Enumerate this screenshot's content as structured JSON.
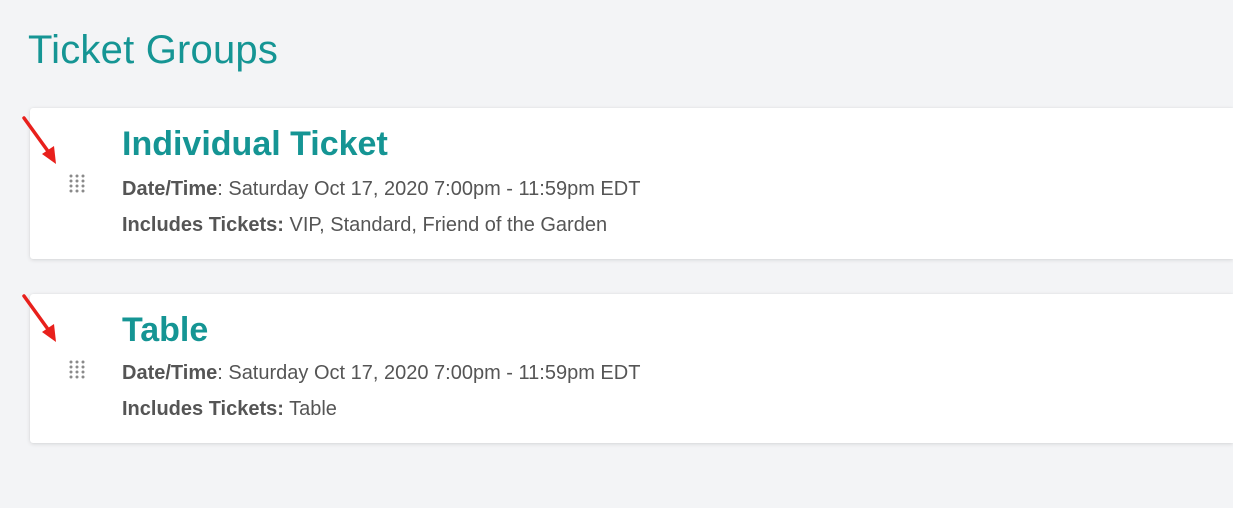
{
  "page": {
    "title": "Ticket Groups"
  },
  "groups": [
    {
      "name": "Individual Ticket",
      "date_label": "Date/Time",
      "date_value": ": Saturday Oct 17, 2020 7:00pm - 11:59pm EDT",
      "tickets_label": "Includes Tickets:",
      "tickets_value": " VIP, Standard, Friend of the Garden"
    },
    {
      "name": "Table",
      "date_label": "Date/Time",
      "date_value": ": Saturday Oct 17, 2020 7:00pm - 11:59pm EDT",
      "tickets_label": "Includes Tickets:",
      "tickets_value": " Table"
    }
  ],
  "icons": {
    "drag_handle": "drag-handle-icon",
    "annotation": "red-arrow-icon"
  },
  "colors": {
    "accent": "#159594",
    "text": "#555555",
    "background": "#f3f4f6",
    "annotation": "#e8201c"
  }
}
